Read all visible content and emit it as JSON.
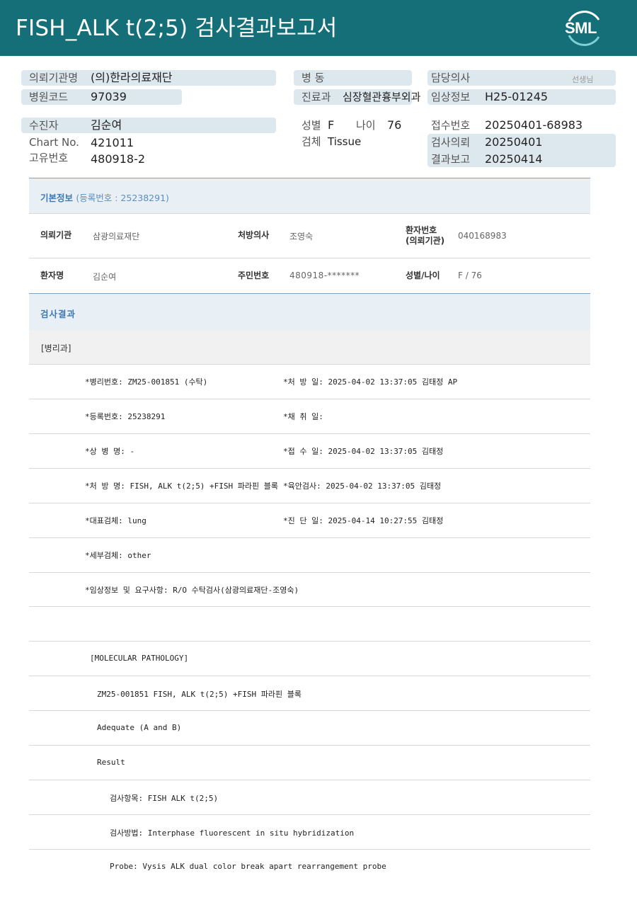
{
  "header": {
    "title": "FISH_ALK t(2;5) 검사결과보고서",
    "logo_text": "SML"
  },
  "patient_info": {
    "requesting_institution": {
      "label": "의뢰기관명",
      "value": "(의)한라의료재단"
    },
    "hospital_code": {
      "label": "병원코드",
      "value": "97039"
    },
    "ward": {
      "label": "병 동",
      "value": ""
    },
    "department": {
      "label": "진료과",
      "value": "심장혈관흉부외과"
    },
    "doctor": {
      "label": "담당의사",
      "suffix": "선생님"
    },
    "clinical_info": {
      "label": "임상정보",
      "value": "H25-01245"
    },
    "examinee": {
      "label": "수진자",
      "value": "김순여"
    },
    "chart_no": {
      "label": "Chart No.",
      "value": "421011"
    },
    "unique_no": {
      "label": "고유번호",
      "value": "480918-2"
    },
    "sex": {
      "label": "성별",
      "value": "F"
    },
    "age": {
      "label": "나이",
      "value": "76"
    },
    "specimen": {
      "label": "검체",
      "value": "Tissue"
    },
    "receipt_no": {
      "label": "접수번호",
      "value": "20250401-68983"
    },
    "test_request": {
      "label": "검사의뢰",
      "value": "20250401"
    },
    "result_report": {
      "label": "결과보고",
      "value": "20250414"
    }
  },
  "basic_info": {
    "heading": "기본정보",
    "registration": "(등록번호 : 25238291)",
    "rows": [
      [
        {
          "key": "의뢰기관",
          "value": "삼광의료재단"
        },
        {
          "key": "처방의사",
          "value": "조영숙"
        },
        {
          "key": "환자번호\n(의뢰기관)",
          "value": "040168983"
        }
      ],
      [
        {
          "key": "환자명",
          "value": "김순여"
        },
        {
          "key": "주민번호",
          "value": "480918-*******"
        },
        {
          "key": "성별/나이",
          "value": "F / 76"
        }
      ]
    ]
  },
  "test_results": {
    "heading": "검사결과",
    "department": "[병리과]",
    "fields": [
      {
        "left": "*병리번호: ZM25-001851 (수탁)",
        "right": "*처 방 일: 2025-04-02 13:37:05  김태정 AP"
      },
      {
        "left": "*등록번호: 25238291",
        "right": "*채 취 일:"
      },
      {
        "left": "*상 병 명: -",
        "right": "*접 수 일: 2025-04-02 13:37:05  김태정"
      },
      {
        "left": "*처 방 명: FISH, ALK t(2;5) +FISH 파라핀 블록",
        "right": "*육안검사: 2025-04-02 13:37:05  김태정"
      },
      {
        "left": "*대표검체: lung",
        "right": "*진 단 일: 2025-04-14 10:27:55  김태정"
      },
      {
        "left": "*세부검체: other",
        "right": ""
      },
      {
        "left": "*임상정보 및 요구사항: R/O 수탁검사(삼광의료재단-조영숙)",
        "right": ""
      }
    ],
    "molecular": [
      "[MOLECULAR PATHOLOGY]",
      "ZM25-001851     FISH, ALK t(2;5) +FISH 파라핀 블록",
      "Adequate (A and B)",
      "Result",
      "검사항목: FISH ALK t(2;5)",
      "검사방법: Interphase fluorescent in situ hybridization",
      "Probe: Vysis ALK dual color break apart rearrangement probe"
    ]
  },
  "colors": {
    "header_bg": "#146f78",
    "pill_bg": "#dde7ee",
    "section_bg": "#e9f0f5",
    "section_text": "#3e7ab6"
  }
}
